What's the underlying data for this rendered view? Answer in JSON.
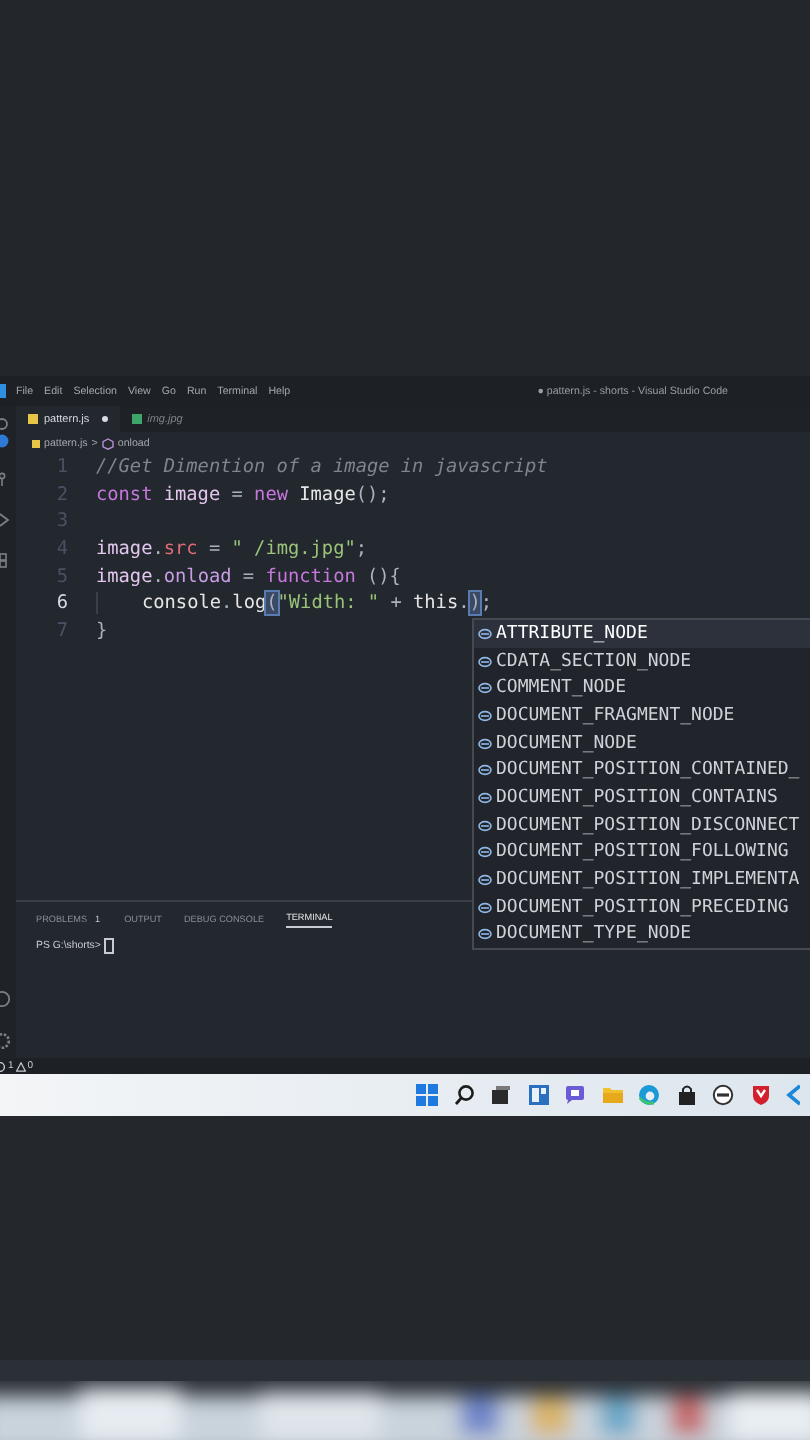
{
  "menu": [
    "File",
    "Edit",
    "Selection",
    "View",
    "Go",
    "Run",
    "Terminal",
    "Help"
  ],
  "window_title": "● pattern.js - shorts - Visual Studio Code",
  "tabs": [
    {
      "label": "pattern.js",
      "kind": "js",
      "selected": true,
      "modified": true
    },
    {
      "label": "img.jpg",
      "selected": false,
      "modified": false
    }
  ],
  "breadcrumbs": [
    "pattern.js",
    ">",
    "onload"
  ],
  "lines": [
    {
      "number": "1",
      "active": false,
      "tokens": [
        {
          "text": "//Get Dimention of a image in javascript",
          "kind": "comment"
        }
      ]
    },
    {
      "number": "2",
      "active": false,
      "tokens": [
        {
          "text": "const",
          "kind": "keyword"
        },
        {
          "text": " image ",
          "kind": "variable"
        },
        {
          "text": "=",
          "kind": "punct"
        },
        {
          "text": " new ",
          "kind": "keyword"
        },
        {
          "text": "Image",
          "kind": "plain"
        },
        {
          "text": "();",
          "kind": "punct"
        }
      ]
    },
    {
      "number": "3",
      "active": false
    },
    {
      "number": "4",
      "active": false,
      "tokens": [
        {
          "text": "image",
          "kind": "variable"
        },
        {
          "text": ".",
          "kind": "punct"
        },
        {
          "text": "src",
          "kind": "property"
        },
        {
          "text": " = ",
          "kind": "punct"
        },
        {
          "text": "\" /img.jpg\"",
          "kind": "string"
        },
        {
          "text": ";",
          "kind": "punct"
        }
      ]
    },
    {
      "number": "5",
      "active": false,
      "tokens": [
        {
          "text": "image",
          "kind": "variable"
        },
        {
          "text": ".",
          "kind": "punct"
        },
        {
          "text": "onload",
          "kind": "method"
        },
        {
          "text": " = ",
          "kind": "punct"
        },
        {
          "text": "function",
          "kind": "keyword"
        },
        {
          "text": " (){",
          "kind": "punct"
        }
      ]
    },
    {
      "number": "6",
      "active": true,
      "indented": true,
      "tokens": [
        {
          "text": "console",
          "kind": "plain"
        },
        {
          "text": ".",
          "kind": "punct"
        },
        {
          "text": "log",
          "kind": "plain"
        },
        {
          "text": "(",
          "kind": "matched"
        },
        {
          "text": "\"Width: \"",
          "kind": "string"
        },
        {
          "text": " + ",
          "kind": "punct"
        },
        {
          "text": "this",
          "kind": "plain"
        },
        {
          "text": ".",
          "kind": "punct"
        },
        {
          "text": ")",
          "kind": "matched"
        },
        {
          "text": ";",
          "kind": "punct"
        }
      ]
    },
    {
      "number": "7",
      "active": false,
      "tokens": [
        {
          "text": "}",
          "kind": "punct"
        }
      ]
    }
  ],
  "suggestions": [
    {
      "label": "ATTRIBUTE_NODE",
      "selected": true
    },
    {
      "label": "CDATA_SECTION_NODE",
      "selected": false
    },
    {
      "label": "COMMENT_NODE",
      "selected": false
    },
    {
      "label": "DOCUMENT_FRAGMENT_NODE",
      "selected": false
    },
    {
      "label": "DOCUMENT_NODE",
      "selected": false
    },
    {
      "label": "DOCUMENT_POSITION_CONTAINED_",
      "selected": false
    },
    {
      "label": "DOCUMENT_POSITION_CONTAINS",
      "selected": false
    },
    {
      "label": "DOCUMENT_POSITION_DISCONNECT",
      "selected": false
    },
    {
      "label": "DOCUMENT_POSITION_FOLLOWING",
      "selected": false
    },
    {
      "label": "DOCUMENT_POSITION_IMPLEMENTA",
      "selected": false
    },
    {
      "label": "DOCUMENT_POSITION_PRECEDING",
      "selected": false
    },
    {
      "label": "DOCUMENT_TYPE_NODE",
      "selected": false
    }
  ],
  "panel_tabs": [
    {
      "label": "PROBLEMS",
      "badge": "1",
      "selected": false
    },
    {
      "label": "OUTPUT",
      "selected": false
    },
    {
      "label": "DEBUG CONSOLE",
      "selected": false
    },
    {
      "label": "TERMINAL",
      "selected": true
    }
  ],
  "terminal_prompt": "PS G:\\shorts>",
  "status_bar": {
    "errors": "1",
    "warnings": "0"
  }
}
